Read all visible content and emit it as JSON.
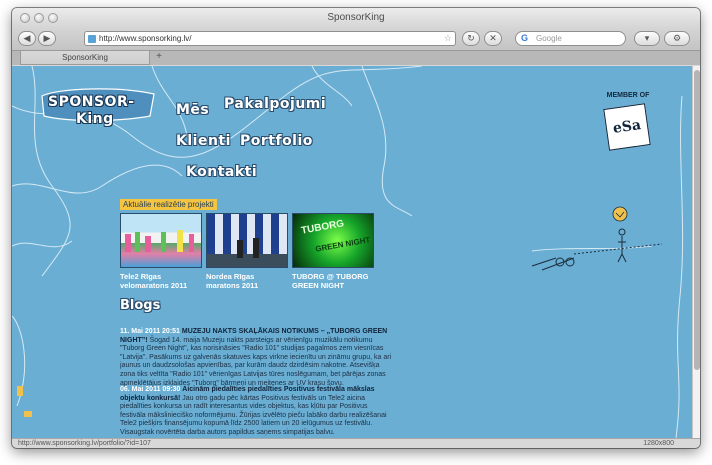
{
  "browser": {
    "window_title": "SponsorKing",
    "url": "http://www.sponsorking.lv/",
    "search_placeholder": "Google",
    "search_engine_glyph": "G",
    "tab_title": "SponsorKing",
    "new_tab_glyph": "+",
    "status_url": "http://www.sponsorking.lv/portfolio/?id=107",
    "resolution": "1280x800",
    "buttons": {
      "back": "◀",
      "forward": "▶",
      "reload": "↻",
      "stop": "✕",
      "rss": "☆",
      "reader": "▾"
    },
    "colors": {
      "chrome": "#d5d5d5",
      "page_bg": "#6aaed3"
    }
  },
  "site": {
    "logo": {
      "line1": "SPONSOR-",
      "line2": "King"
    },
    "nav": [
      {
        "label": "Mēs"
      },
      {
        "label": "Pakalpojumi"
      },
      {
        "label": "Klienti"
      },
      {
        "label": "Portfolio"
      },
      {
        "label": "Kontakti"
      }
    ],
    "member_of": {
      "label": "MEMBER OF",
      "badge": "eSa"
    },
    "projects_label": "Aktuālie realizētie projekti",
    "projects": [
      {
        "title": "Tele2 Rīgas velomaratons 2011"
      },
      {
        "title": "Nordea Rīgas maratons 2011"
      },
      {
        "title": "TUBORG @ TUBORG GREEN NIGHT"
      }
    ],
    "tuborg_thumb_text": {
      "brand": "TUBORG",
      "tagline": "GREEN NIGHT"
    },
    "blogs_heading": "Blogs",
    "blogs": [
      {
        "date": "11. Mai 2011 20:51",
        "headline": "MUZEJU NAKTS SKAĻĀKAIS NOTIKUMS – „TUBORG GREEN NIGHT”!",
        "body": "Šogad 14. maija Muzeju nakts parsteigs ar vērienīgu muzikālu notikumu \"Tuborg Green Night\", kas norisināsies \"Radio 101\" studijas pagalmos zem viesnīcas \"Latvija\". Pasākums uz galvenās skatuves kaps virkne iecienītu un zināmu grupu, ka ari jaunus un daudzsološas apvienības, par kurām daudz dzirdēsim nakotne. Atsevišķa zona tiks veltīta \"Radio 101\" vērienīgas Latvijas tūres noslēgumam, bet pārējas zonas apmeklētājus izklaides \"Tuborg\" bārmeņi un meitenes ar UV krasu šovu."
      },
      {
        "date": "06. Mai 2011 09:30",
        "headline": "Aicinām piedalīties piedalīties Positivus festivāla mākslas objektu konkursā!",
        "body": "Jau otro gadu pēc kārtas Positivus festivāls un Tele2 aicina piedalīties konkursa un radīt interesantus vides objektus, kas kļūtu par Positivus festivāla mākslinieciško noformējumu. Žūrijas izvēlēto pieču labāko darbu realizēšanai Tele2 piešķirs finansējumu kopumā līdz 2500 latiem un 20 ielūgumus uz festivālu. Visaugstak novērtēta darba autors papildus saņems simpatijas balvu."
      }
    ]
  }
}
